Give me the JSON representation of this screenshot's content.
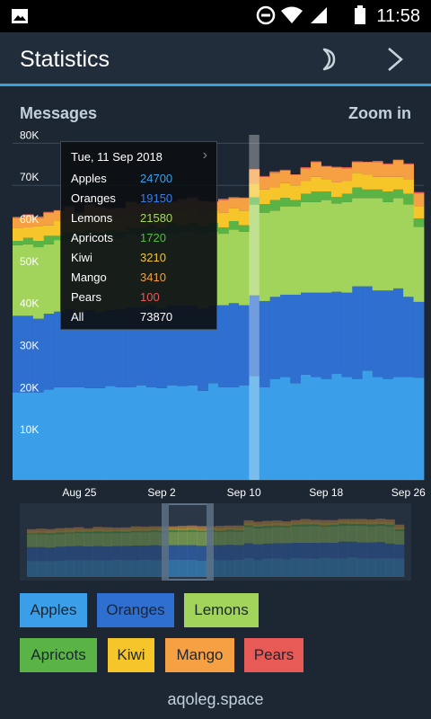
{
  "status_bar": {
    "time": "11:58",
    "icons": [
      "image-icon",
      "do-not-disturb-icon",
      "wifi-icon",
      "signal-icon",
      "battery-icon"
    ]
  },
  "app_bar": {
    "title": "Statistics",
    "icons": [
      "night-mode-moon-icon",
      "chevron-right-icon"
    ]
  },
  "chart_header": {
    "title": "Messages",
    "action": "Zoom in"
  },
  "tooltip": {
    "date": "Tue, 11 Sep 2018",
    "rows": [
      {
        "name": "Apples",
        "value": "24700",
        "color": "#3aa0e8"
      },
      {
        "name": "Oranges",
        "value": "19150",
        "color": "#2f7ff0"
      },
      {
        "name": "Lemons",
        "value": "21580",
        "color": "#a4d95a"
      },
      {
        "name": "Apricots",
        "value": "1720",
        "color": "#55bb44"
      },
      {
        "name": "Kiwi",
        "value": "3210",
        "color": "#f5c52a"
      },
      {
        "name": "Mango",
        "value": "3410",
        "color": "#f0a040"
      },
      {
        "name": "Pears",
        "value": "100",
        "color": "#e85a5a"
      },
      {
        "name": "All",
        "value": "73870",
        "color": "#ffffff"
      }
    ]
  },
  "filters": [
    {
      "label": "Apples",
      "color": "#3a9ee8"
    },
    {
      "label": "Oranges",
      "color": "#2f6fd0"
    },
    {
      "label": "Lemons",
      "color": "#a2d35a"
    },
    {
      "label": "Apricots",
      "color": "#5ab445"
    },
    {
      "label": "Kiwi",
      "color": "#f5c52a"
    },
    {
      "label": "Mango",
      "color": "#f5a042"
    },
    {
      "label": "Pears",
      "color": "#e85a55"
    }
  ],
  "footer": "aqoleg.space",
  "chart_data": {
    "type": "area",
    "stacked": true,
    "title": "Messages",
    "xlabel": "",
    "ylabel": "",
    "x_ticks": [
      "Aug 25",
      "Sep 2",
      "Sep 10",
      "Sep 18",
      "Sep 26"
    ],
    "y_ticks": [
      "10K",
      "20K",
      "30K",
      "40K",
      "50K",
      "60K",
      "70K",
      "80K"
    ],
    "ylim": [
      0,
      82000
    ],
    "highlighted_date": "Tue, 11 Sep 2018",
    "grid": true,
    "x": [
      "Aug 19",
      "Aug 20",
      "Aug 21",
      "Aug 22",
      "Aug 23",
      "Aug 24",
      "Aug 25",
      "Aug 26",
      "Aug 27",
      "Aug 28",
      "Aug 29",
      "Aug 30",
      "Aug 31",
      "Sep 1",
      "Sep 2",
      "Sep 3",
      "Sep 4",
      "Sep 5",
      "Sep 6",
      "Sep 7",
      "Sep 8",
      "Sep 9",
      "Sep 10",
      "Sep 11",
      "Sep 12",
      "Sep 13",
      "Sep 14",
      "Sep 15",
      "Sep 16",
      "Sep 17",
      "Sep 18",
      "Sep 19",
      "Sep 20",
      "Sep 21",
      "Sep 22",
      "Sep 23",
      "Sep 24",
      "Sep 25",
      "Sep 26",
      "Sep 27"
    ],
    "series": [
      {
        "name": "Apples",
        "color": "#3a9ee8",
        "values": [
          20800,
          20800,
          20800,
          21500,
          22000,
          22000,
          22000,
          21800,
          21800,
          22300,
          22000,
          22000,
          22500,
          22000,
          21800,
          22500,
          22300,
          22500,
          21200,
          23000,
          22000,
          22000,
          22500,
          24700,
          22000,
          24000,
          24500,
          23000,
          25000,
          24500,
          24000,
          25200,
          24500,
          24000,
          26000,
          24500,
          24000,
          24500,
          24500,
          24300
        ]
      },
      {
        "name": "Oranges",
        "color": "#2f6fd0",
        "values": [
          18200,
          18200,
          17500,
          18000,
          18000,
          18500,
          17800,
          18500,
          18000,
          18000,
          18500,
          19000,
          18500,
          19500,
          19000,
          19000,
          19200,
          19000,
          19500,
          18500,
          19500,
          20000,
          19000,
          19150,
          20500,
          19500,
          19500,
          21000,
          19500,
          20000,
          20500,
          19500,
          20000,
          22000,
          20000,
          20500,
          21000,
          21000,
          19000,
          18000
        ]
      },
      {
        "name": "Lemons",
        "color": "#a2d35a",
        "values": [
          16800,
          17000,
          17000,
          16500,
          17000,
          16800,
          17500,
          17000,
          17500,
          17000,
          17000,
          17500,
          17000,
          17500,
          17200,
          17000,
          17500,
          17500,
          18000,
          17500,
          17000,
          17500,
          17500,
          21580,
          21000,
          20500,
          21000,
          21000,
          21500,
          21500,
          22000,
          21000,
          21500,
          21000,
          21000,
          22000,
          21000,
          21500,
          22000,
          17800
        ]
      },
      {
        "name": "Apricots",
        "color": "#5ab445",
        "values": [
          1000,
          1500,
          1500,
          2000,
          1000,
          1500,
          1500,
          2000,
          1500,
          2000,
          1500,
          1500,
          2000,
          1500,
          2000,
          2500,
          1500,
          2000,
          1500,
          2000,
          1500,
          2000,
          1500,
          1720,
          2000,
          2500,
          2000,
          1500,
          2000,
          2500,
          2000,
          1500,
          2000,
          2500,
          2000,
          2000,
          2500,
          2000,
          2500,
          2000
        ]
      },
      {
        "name": "Kiwi",
        "color": "#f5c52a",
        "values": [
          3000,
          2500,
          3500,
          2500,
          3500,
          3000,
          2500,
          3500,
          3000,
          2500,
          3500,
          3000,
          3000,
          2500,
          3500,
          3000,
          3000,
          3500,
          2500,
          3000,
          3500,
          3000,
          3500,
          3210,
          3500,
          3000,
          3500,
          3500,
          3000,
          3500,
          3000,
          3500,
          3000,
          3500,
          3500,
          3000,
          3500,
          3000,
          3500,
          3000
        ]
      },
      {
        "name": "Mango",
        "color": "#f5a042",
        "values": [
          2500,
          3000,
          2000,
          3000,
          2500,
          3000,
          2000,
          2500,
          3000,
          2500,
          2000,
          3000,
          2500,
          3000,
          2500,
          2000,
          3000,
          2500,
          3500,
          2000,
          3000,
          2500,
          3000,
          3410,
          3000,
          3500,
          3000,
          2500,
          3000,
          3500,
          3000,
          3500,
          3000,
          2500,
          3000,
          3500,
          3000,
          4000,
          3500,
          3000
        ]
      },
      {
        "name": "Pears",
        "color": "#e85a55",
        "values": [
          200,
          100,
          300,
          200,
          100,
          300,
          200,
          200,
          100,
          300,
          200,
          100,
          200,
          300,
          100,
          200,
          300,
          200,
          100,
          200,
          300,
          200,
          100,
          100,
          200,
          300,
          200,
          100,
          300,
          200,
          100,
          200,
          300,
          200,
          100,
          300,
          200,
          100,
          200,
          300
        ]
      }
    ]
  }
}
